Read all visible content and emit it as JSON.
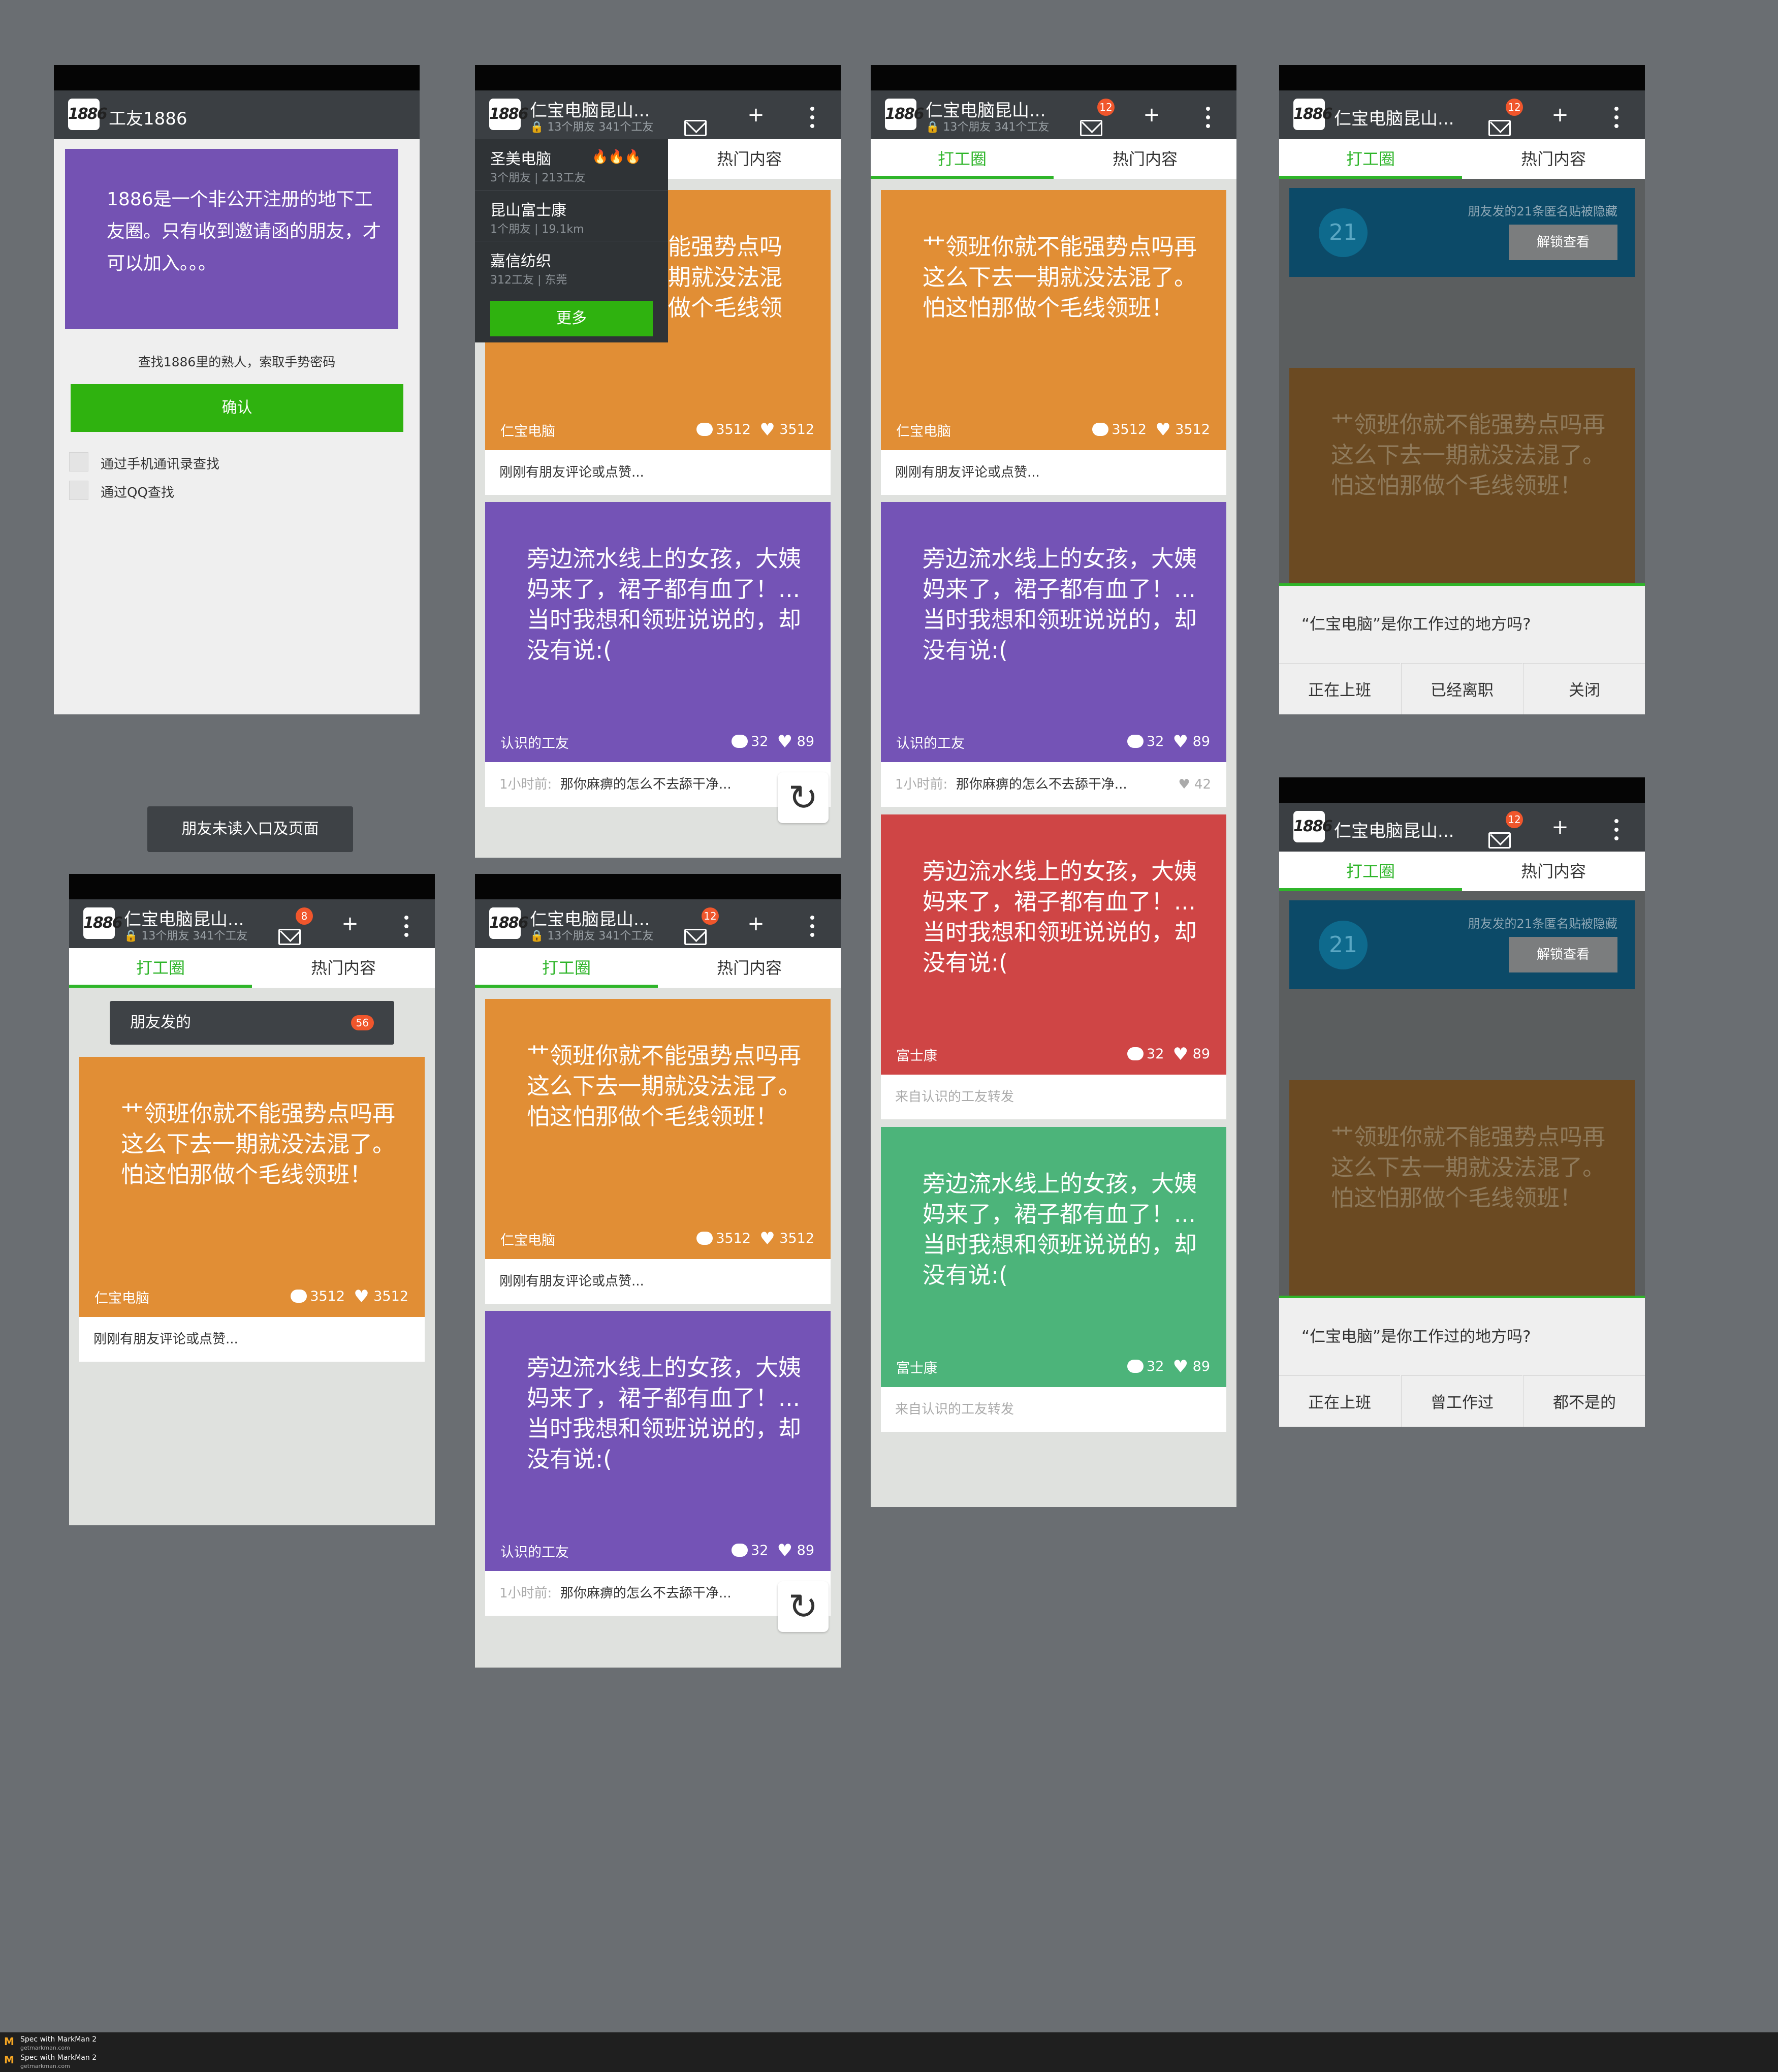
{
  "app": {
    "name": "工友1886",
    "group": "仁宝电脑昆山...",
    "group_stats": "13个朋友  341个工友",
    "badge_a": "8",
    "badge_b": "12",
    "tab_work": "打工圈",
    "tab_hot": "热门内容"
  },
  "invite": {
    "intro": "1886是一个非公开注册的地下工友圈。只有收到邀请函的朋友，才可以加入。。。",
    "prompt": "查找1886里的熟人，索取手势密码",
    "confirm": "确认",
    "option_contacts": "通过手机通讯录查找",
    "option_qq": "通过QQ查找"
  },
  "label_friend_unread": "朋友未读入口及页面",
  "dropdown": {
    "items": [
      {
        "name": "圣美电脑",
        "meta": "3个朋友  |  213工友"
      },
      {
        "name": "昆山富士康",
        "meta": "1个朋友  |  19.1km"
      },
      {
        "name": "嘉信纺织",
        "meta": "312工友  |  东莞"
      }
    ],
    "more": "更多"
  },
  "friends_posted": {
    "label": "朋友发的",
    "count": "56"
  },
  "posts": {
    "orange_text": "艹领班你就不能强势点吗再这么下去一期就没法混了。怕这怕那做个毛线领班！",
    "orange_text_overlap": "能强势点吗期就没法混做个毛线领",
    "orange_source": "仁宝电脑",
    "orange_comments": "3512",
    "orange_likes": "3512",
    "orange_footer": "刚刚有朋友评论或点赞...",
    "purple_text": "旁边流水线上的女孩，大姨妈来了，裙子都有血了！...当时我想和领班说说的，却没有说:(",
    "purple_source": "认识的工友",
    "purple_comments": "32",
    "purple_likes": "89",
    "purple_footer_time": "1小时前:",
    "purple_footer_text": "那你麻痹的怎么不去舔干净...",
    "purple_footer_likes": "42",
    "red_source": "富士康",
    "green_source": "富士康",
    "repost_footer": "来自认识的工友转发"
  },
  "locked": {
    "number": "21",
    "hint": "朋友发的21条匿名贴被隐藏",
    "unlock": "解锁查看"
  },
  "workplace_dialog": {
    "question": "“仁宝电脑”是你工作过的地方吗?",
    "a_working": "正在上班",
    "a_resigned": "已经离职",
    "a_close": "关闭",
    "b_worked": "曾工作过",
    "b_none": "都不是的"
  },
  "footer_brand": {
    "title": "Spec with MarkMan 2",
    "url": "getmarkman.com"
  },
  "colors": {
    "green": "#2fb52a",
    "orange": "#e18e35",
    "purple": "#7453b6",
    "red": "#cf4545",
    "teal": "#4cb47a",
    "appbar": "#3b3f43"
  }
}
